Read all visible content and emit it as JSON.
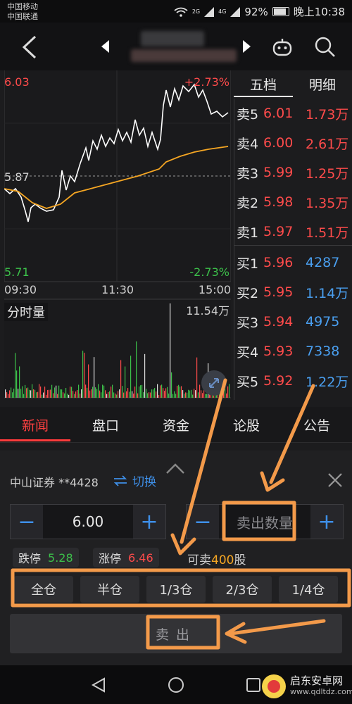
{
  "status": {
    "carrier1": "中国移动",
    "carrier2": "中国联通",
    "net1": "2G",
    "net2": "4G",
    "battery": "92%",
    "time": "晚上10:38"
  },
  "header": {
    "back_icon": "chevron-left-icon",
    "robot_icon": "robot-icon",
    "search_icon": "search-icon"
  },
  "chart": {
    "high_price": "6.03",
    "high_pct": "+2.73%",
    "prev_close": "5.87",
    "low_price": "5.71",
    "low_pct": "-2.73%",
    "time_start": "09:30",
    "time_mid": "11:30",
    "time_end": "15:00",
    "volume_title": "分时量",
    "volume_max": "11.54万",
    "up_color": "#ff4b4b",
    "down_color": "#3cc04a",
    "avg_color": "#f5a623"
  },
  "orderbook": {
    "tab_five": "五档",
    "tab_detail": "明细",
    "sell": [
      {
        "label": "卖5",
        "price": "6.01",
        "vol": "1.73万"
      },
      {
        "label": "卖4",
        "price": "6.00",
        "vol": "2.61万"
      },
      {
        "label": "卖3",
        "price": "5.99",
        "vol": "1.25万"
      },
      {
        "label": "卖2",
        "price": "5.98",
        "vol": "1.35万"
      },
      {
        "label": "卖1",
        "price": "5.97",
        "vol": "1.51万"
      }
    ],
    "buy": [
      {
        "label": "买1",
        "price": "5.96",
        "vol": "4287"
      },
      {
        "label": "买2",
        "price": "5.95",
        "vol": "1.14万"
      },
      {
        "label": "买3",
        "price": "5.94",
        "vol": "4975"
      },
      {
        "label": "买4",
        "price": "5.93",
        "vol": "7338"
      },
      {
        "label": "买5",
        "price": "5.92",
        "vol": "1.22万"
      }
    ]
  },
  "tabs": [
    "新闻",
    "盘口",
    "资金",
    "论股",
    "公告"
  ],
  "trade": {
    "account": "中山证券 **4428",
    "switch_label": "切换",
    "price_value": "6.00",
    "qty_placeholder": "卖出数量",
    "limit_down_label": "跌停",
    "limit_down_value": "5.28",
    "limit_up_label": "涨停",
    "limit_up_value": "6.46",
    "sellable_prefix": "可卖",
    "sellable_qty": "400",
    "sellable_unit": "股",
    "positions": [
      "全仓",
      "半仓",
      "1/3仓",
      "2/3仓",
      "1/4仓"
    ],
    "sell_label": "卖出"
  },
  "watermark": {
    "name": "启东安卓网",
    "url": "www.qdltdz.com"
  }
}
